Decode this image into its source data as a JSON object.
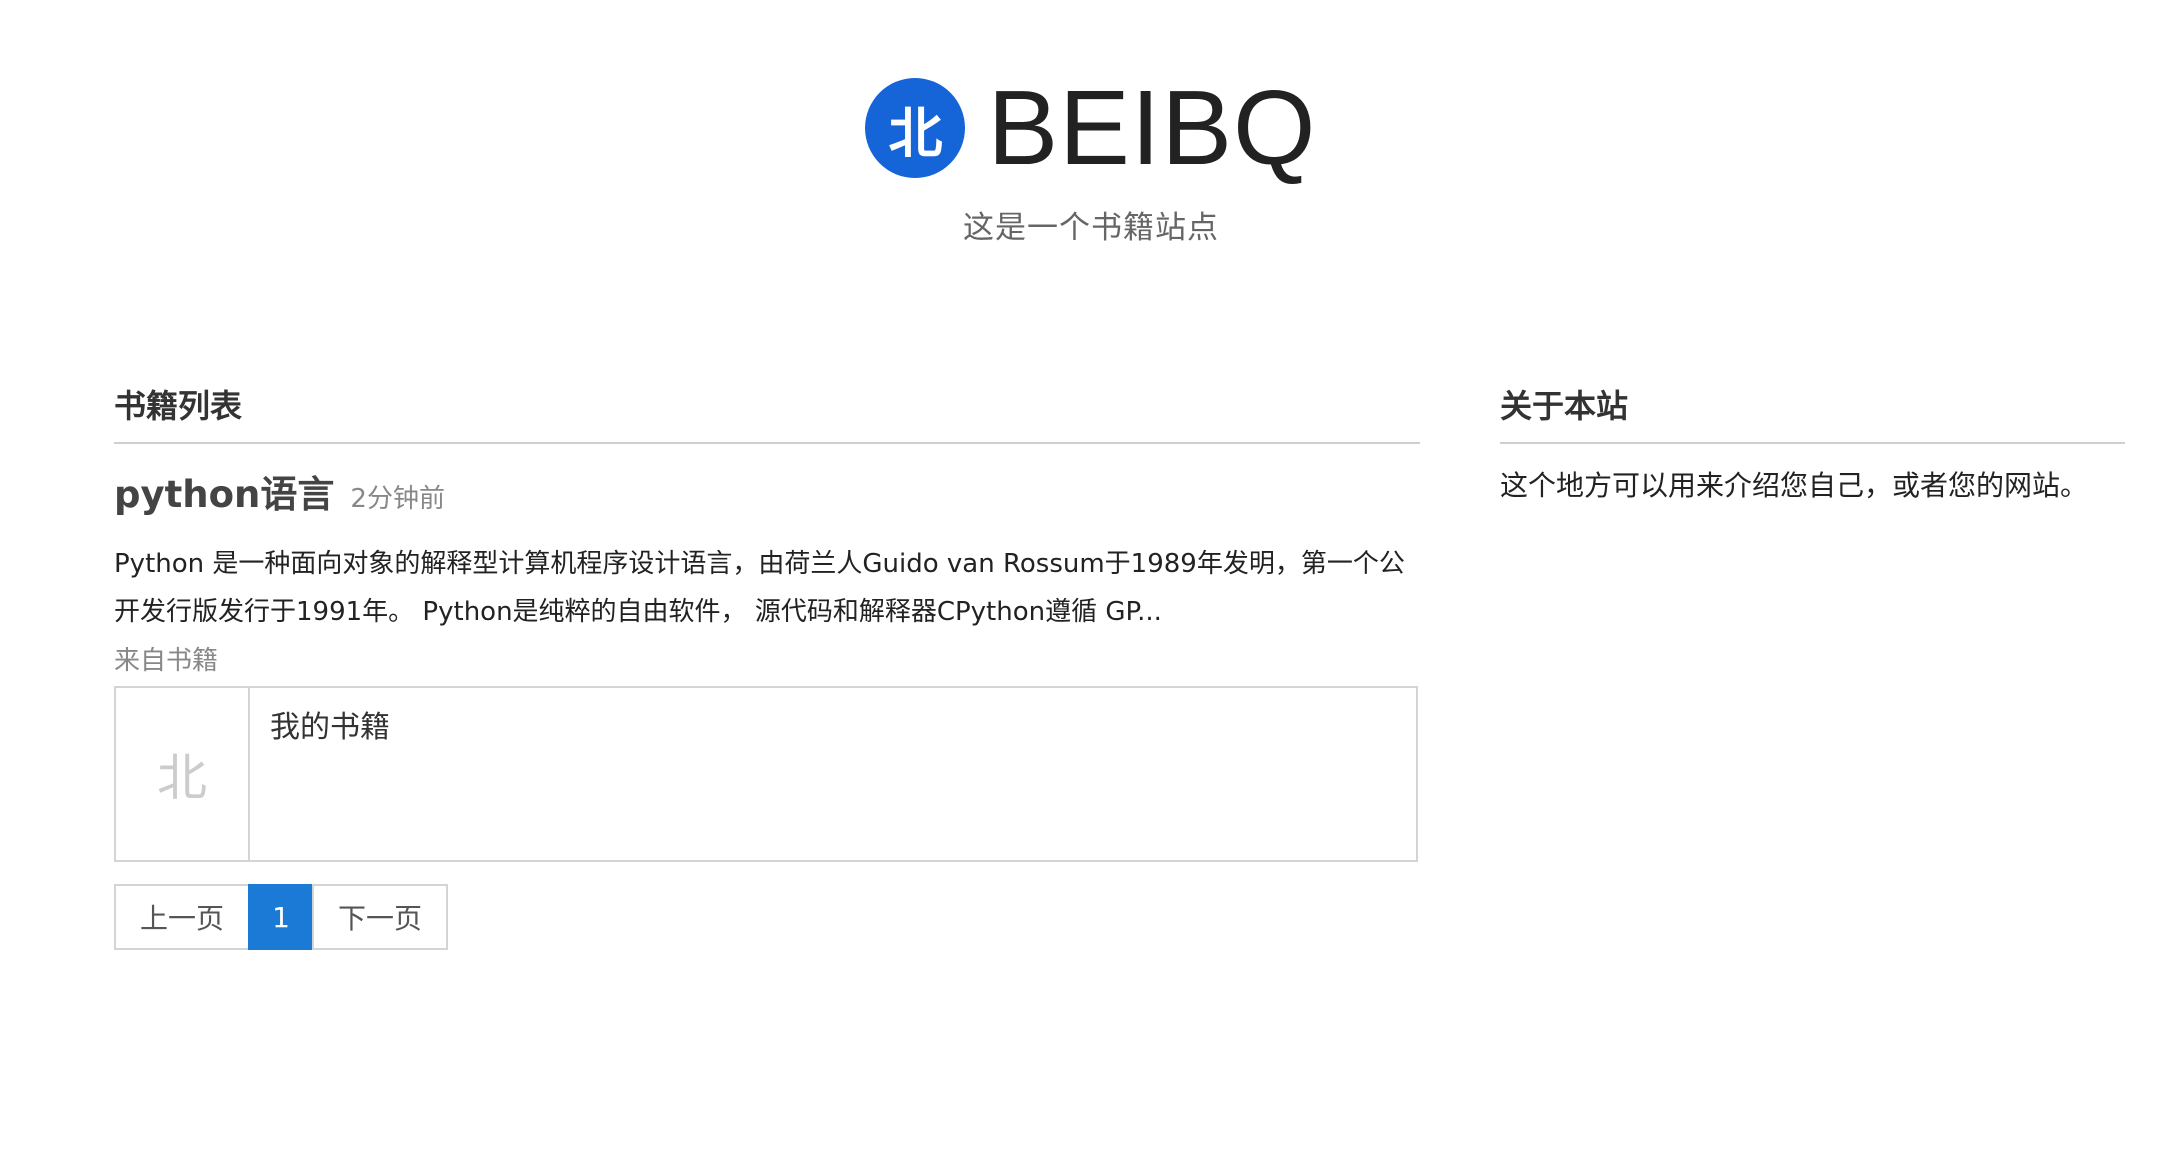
{
  "header": {
    "logo_char": "北",
    "brand_name": "BEIBQ",
    "tagline": "这是一个书籍站点"
  },
  "main": {
    "heading": "书籍列表",
    "posts": [
      {
        "title": "python语言",
        "time": "2分钟前",
        "excerpt": "Python 是一种面向对象的解释型计算机程序设计语言，由荷兰人Guido van Rossum于1989年发明，第一个公开发行版发行于1991年。 Python是纯粹的自由软件， 源代码和解释器CPython遵循 GP...",
        "from_label": "来自书籍",
        "book": {
          "cover_char": "北",
          "title": "我的书籍"
        }
      }
    ],
    "pagination": {
      "prev": "上一页",
      "current": "1",
      "next": "下一页"
    }
  },
  "sidebar": {
    "heading": "关于本站",
    "about": "这个地方可以用来介绍您自己，或者您的网站。"
  },
  "colors": {
    "brand": "#1565d8",
    "accent": "#1a7ad6"
  }
}
